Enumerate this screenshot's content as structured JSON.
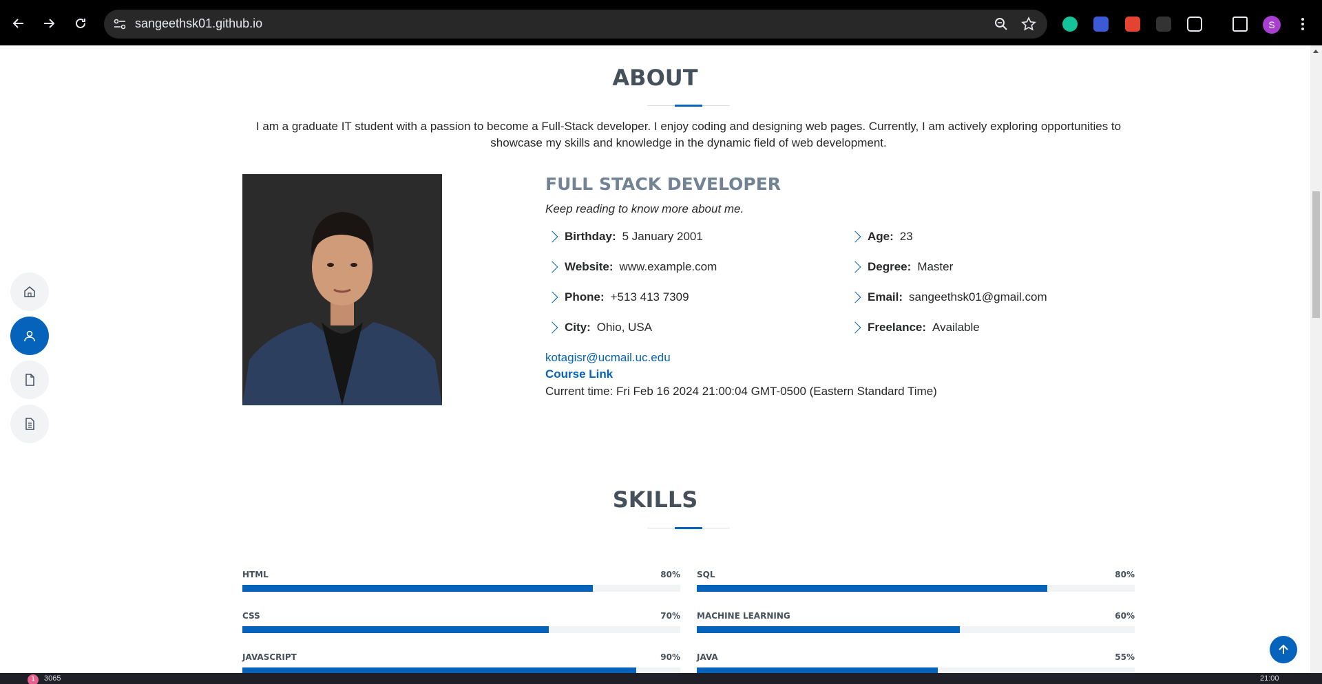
{
  "browser": {
    "url": "sangeethsk01.github.io",
    "profile_initial": "S"
  },
  "sidenav": {
    "items": [
      {
        "icon": "home-icon",
        "active": false
      },
      {
        "icon": "person-icon",
        "active": true
      },
      {
        "icon": "file-icon",
        "active": false
      },
      {
        "icon": "document-icon",
        "active": false
      }
    ]
  },
  "about": {
    "title": "ABOUT",
    "text": "I am a graduate IT student with a passion to become a Full-Stack developer. I enjoy coding and designing web pages. Currently, I am actively exploring opportunities to showcase my skills and knowledge in the dynamic field of web development.",
    "role": "FULL STACK DEVELOPER",
    "tagline": "Keep reading to know more about me.",
    "left": [
      {
        "k": "Birthday:",
        "v": "5 January 2001"
      },
      {
        "k": "Website:",
        "v": "www.example.com"
      },
      {
        "k": "Phone:",
        "v": "+513 413 7309"
      },
      {
        "k": "City:",
        "v": "Ohio, USA"
      }
    ],
    "right": [
      {
        "k": "Age:",
        "v": "23"
      },
      {
        "k": "Degree:",
        "v": "Master"
      },
      {
        "k": "Email:",
        "v": "sangeethsk01@gmail.com"
      },
      {
        "k": "Freelance:",
        "v": "Available"
      }
    ],
    "email_link": "kotagisr@ucmail.uc.edu",
    "course_link": "Course Link",
    "current_time": "Current time: Fri Feb 16 2024 21:00:04 GMT-0500 (Eastern Standard Time)"
  },
  "skills": {
    "title": "SKILLS",
    "left": [
      {
        "name": "HTML",
        "pct": "80%",
        "value": 80
      },
      {
        "name": "CSS",
        "pct": "70%",
        "value": 70
      },
      {
        "name": "JAVASCRIPT",
        "pct": "90%",
        "value": 90
      }
    ],
    "right": [
      {
        "name": "SQL",
        "pct": "80%",
        "value": 80
      },
      {
        "name": "MACHINE LEARNING",
        "pct": "60%",
        "value": 60
      },
      {
        "name": "JAVA",
        "pct": "55%",
        "value": 55
      }
    ]
  },
  "taskbar": {
    "badge": "1",
    "text": "3065",
    "time": "21:00"
  },
  "colors": {
    "accent": "#0563bb",
    "heading": "#45505b",
    "role": "#728394"
  }
}
